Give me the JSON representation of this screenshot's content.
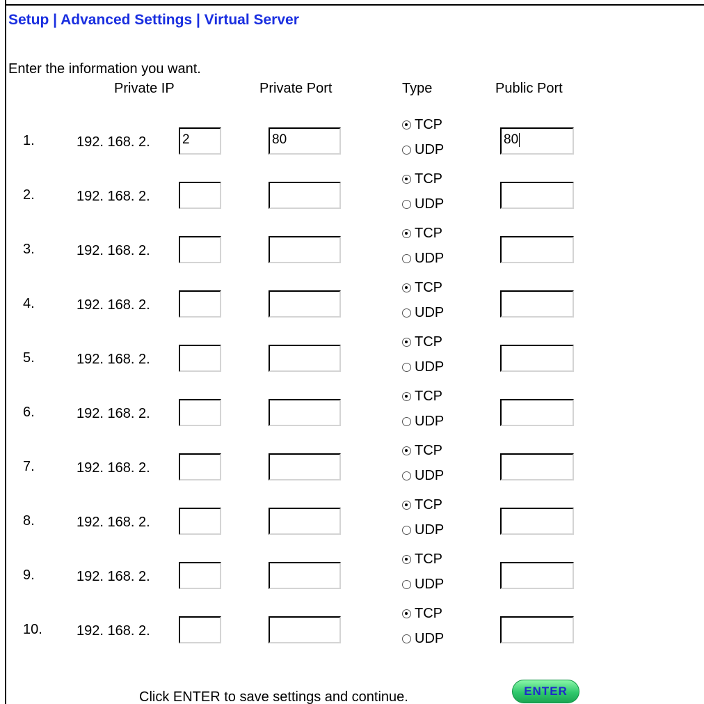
{
  "breadcrumb": "Setup | Advanced Settings | Virtual Server",
  "intro": "Enter the information you want.",
  "columns": {
    "private_ip": "Private IP",
    "private_port": "Private Port",
    "type": "Type",
    "public_port": "Public Port"
  },
  "ip_prefix": "192. 168. 2.",
  "type_labels": {
    "tcp": "TCP",
    "udp": "UDP"
  },
  "rows": [
    {
      "num": "1.",
      "ip": "2",
      "private_port": "80",
      "public_port": "80",
      "type": "TCP"
    },
    {
      "num": "2.",
      "ip": "",
      "private_port": "",
      "public_port": "",
      "type": "TCP"
    },
    {
      "num": "3.",
      "ip": "",
      "private_port": "",
      "public_port": "",
      "type": "TCP"
    },
    {
      "num": "4.",
      "ip": "",
      "private_port": "",
      "public_port": "",
      "type": "TCP"
    },
    {
      "num": "5.",
      "ip": "",
      "private_port": "",
      "public_port": "",
      "type": "TCP"
    },
    {
      "num": "6.",
      "ip": "",
      "private_port": "",
      "public_port": "",
      "type": "TCP"
    },
    {
      "num": "7.",
      "ip": "",
      "private_port": "",
      "public_port": "",
      "type": "TCP"
    },
    {
      "num": "8.",
      "ip": "",
      "private_port": "",
      "public_port": "",
      "type": "TCP"
    },
    {
      "num": "9.",
      "ip": "",
      "private_port": "",
      "public_port": "",
      "type": "TCP"
    },
    {
      "num": "10.",
      "ip": "",
      "private_port": "",
      "public_port": "",
      "type": "TCP"
    }
  ],
  "footer_text": "Click ENTER to save settings and continue.",
  "enter_label": "ENTER",
  "colors": {
    "breadcrumb": "#1a2fe0",
    "enter_button": "#2fc86c",
    "enter_text": "#1f2ac9"
  }
}
